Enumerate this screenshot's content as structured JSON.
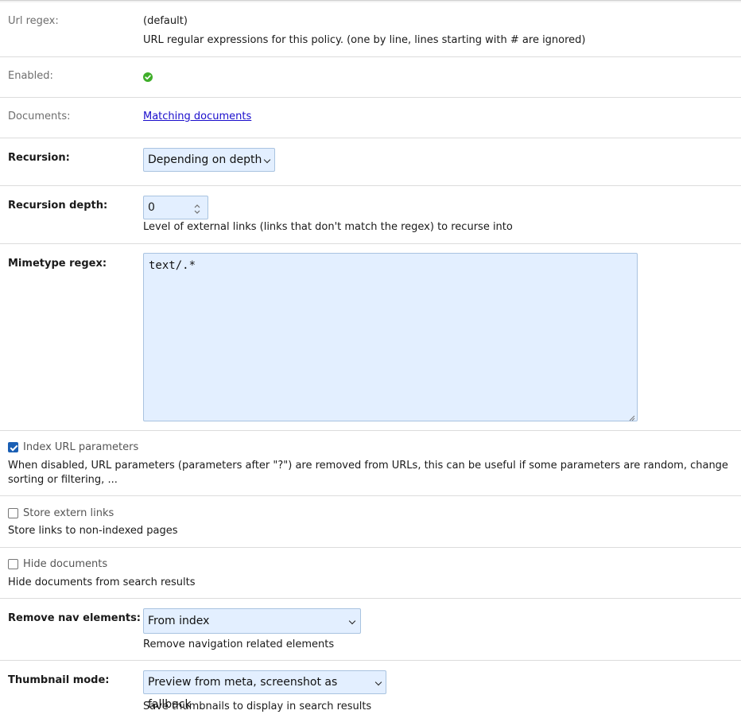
{
  "url_regex": {
    "label": "Url regex:",
    "value": "(default)",
    "help": "URL regular expressions for this policy. (one by line, lines starting with # are ignored)"
  },
  "enabled": {
    "label": "Enabled:",
    "icon": "check-circle-icon",
    "color": "#3fae2a"
  },
  "documents": {
    "label": "Documents:",
    "link_text": "Matching documents"
  },
  "recursion": {
    "label": "Recursion:",
    "selected": "Depending on depth"
  },
  "recursion_depth": {
    "label": "Recursion depth:",
    "value": "0",
    "help": "Level of external links (links that don't match the regex) to recurse into"
  },
  "mimetype_regex": {
    "label": "Mimetype regex:",
    "value": "text/.*"
  },
  "index_url_params": {
    "label": "Index URL parameters",
    "checked": true,
    "help": "When disabled, URL parameters (parameters after \"?\") are removed from URLs, this can be useful if some parameters are random, change sorting or filtering, ..."
  },
  "store_extern_links": {
    "label": "Store extern links",
    "checked": false,
    "help": "Store links to non-indexed pages"
  },
  "hide_documents": {
    "label": "Hide documents",
    "checked": false,
    "help": "Hide documents from search results"
  },
  "remove_nav": {
    "label": "Remove nav elements:",
    "selected": "From index",
    "help": "Remove navigation related elements"
  },
  "thumbnail_mode": {
    "label": "Thumbnail mode:",
    "selected": "Preview from meta, screenshot as fallback",
    "help": "Save thumbnails to display in search results"
  },
  "colors": {
    "input_bg": "#e3efff",
    "input_border": "#a9c3e0",
    "link": "#1a0dcc",
    "checkbox_accent": "#1a5fb4"
  }
}
